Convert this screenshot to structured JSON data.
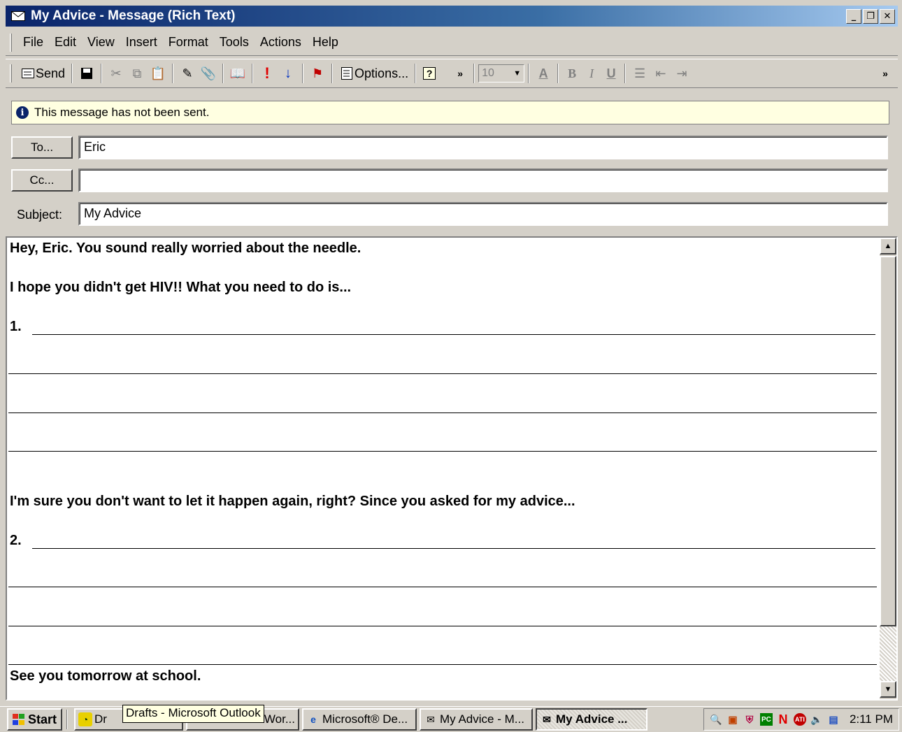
{
  "window": {
    "title": "My Advice - Message (Rich Text)",
    "minimize": "_",
    "restore": "❐",
    "close": "✕"
  },
  "menu": [
    "File",
    "Edit",
    "View",
    "Insert",
    "Format",
    "Tools",
    "Actions",
    "Help"
  ],
  "toolbar": {
    "send_label": "Send",
    "options_label": "Options...",
    "font_size": "10",
    "bold": "B",
    "italic": "I",
    "underline": "U"
  },
  "info_bar": {
    "message": "This message has not been sent."
  },
  "header": {
    "to_button": "To...",
    "to_value": "Eric",
    "cc_button": "Cc...",
    "cc_value": "",
    "subject_label": "Subject:",
    "subject_value": "My Advice"
  },
  "body": {
    "line1": "Hey, Eric.  You sound really worried about the needle.",
    "line2": "I hope you didn't get HIV!!  What you need to do is...",
    "item1": "1.",
    "line3": "I'm sure you don't want to let it happen again, right?  Since you asked for my advice...",
    "item2": "2.",
    "closing": "See you tomorrow at school."
  },
  "taskbar": {
    "start": "Start",
    "tasks": [
      "Dr",
      "ft Wor...",
      "Microsoft® De...",
      "My Advice - M...",
      "My Advice ..."
    ],
    "tooltip": "Drafts - Microsoft Outlook",
    "clock": "2:11 PM"
  }
}
